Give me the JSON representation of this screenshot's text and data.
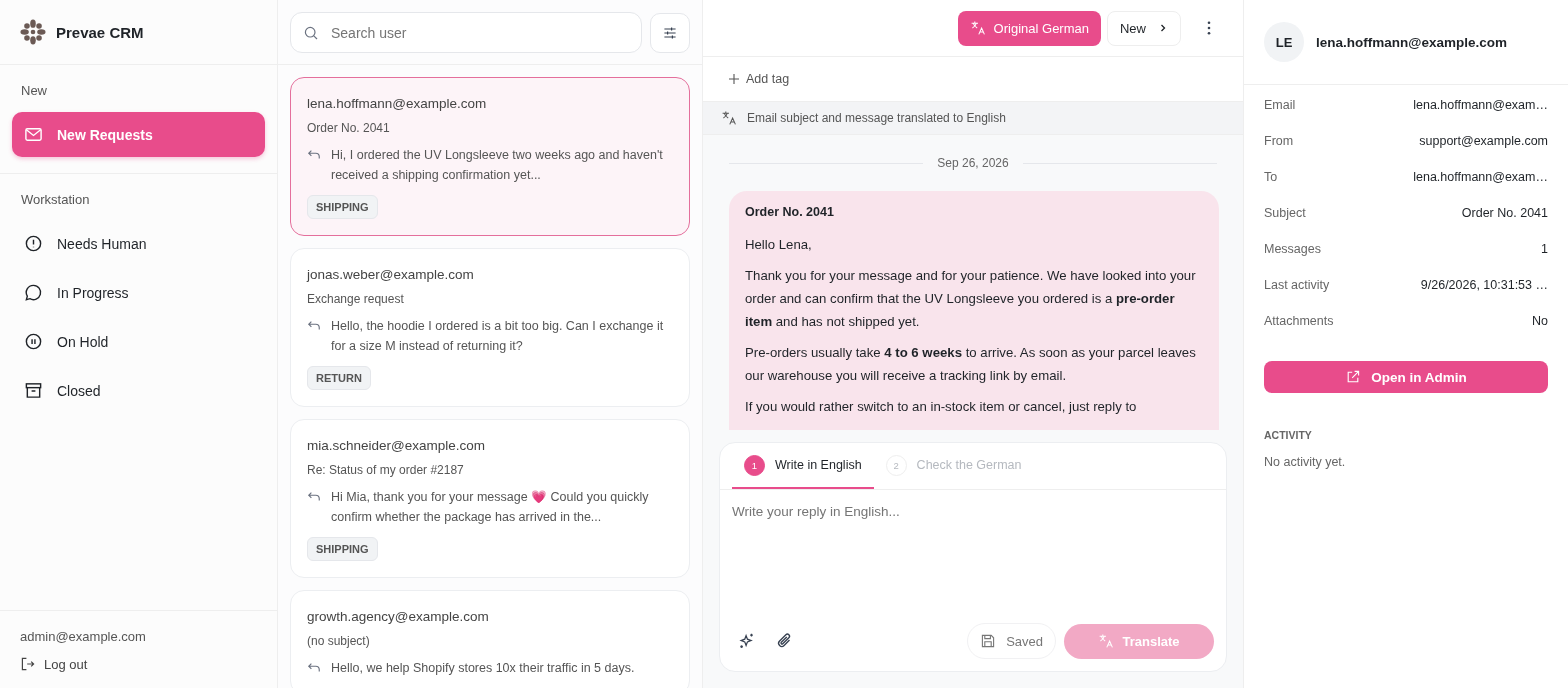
{
  "app": {
    "name": "Prevae CRM"
  },
  "sidebar": {
    "sections": [
      {
        "label": "New",
        "items": [
          {
            "label": "New Requests",
            "kind": "inbox",
            "selected": true
          }
        ]
      },
      {
        "label": "Workstation",
        "items": [
          {
            "label": "Needs Human",
            "kind": "alert",
            "selected": false
          },
          {
            "label": "In Progress",
            "kind": "chat",
            "selected": false
          },
          {
            "label": "On Hold",
            "kind": "pause",
            "selected": false
          },
          {
            "label": "Closed",
            "kind": "archive",
            "selected": false
          }
        ]
      }
    ],
    "user": "admin@example.com",
    "logout": "Log out"
  },
  "search": {
    "placeholder": "Search user"
  },
  "conversations": [
    {
      "email": "lena.hoffmann@example.com",
      "subject": "Order No. 2041",
      "preview": "Hi, I ordered the UV Longsleeve two weeks ago and haven't received a shipping confirmation yet...",
      "tag": "SHIPPING",
      "selected": true
    },
    {
      "email": "jonas.weber@example.com",
      "subject": "Exchange request",
      "preview": "Hello, the hoodie I ordered is a bit too big. Can I exchange it for a size M instead of returning it?",
      "tag": "RETURN",
      "selected": false
    },
    {
      "email": "mia.schneider@example.com",
      "subject": "Re: Status of my order #2187",
      "preview": "Hi Mia, thank you for your message 💗 Could you quickly confirm whether the package has arrived in the...",
      "tag": "SHIPPING",
      "selected": false
    },
    {
      "email": "growth.agency@example.com",
      "subject": "(no subject)",
      "preview": "Hello, we help Shopify stores 10x their traffic in 5 days.",
      "selected": false
    }
  ],
  "thread": {
    "original_button": "Original German",
    "status_button": "New",
    "add_tag": "Add tag",
    "translation_note": "Email subject and message translated to English",
    "date": "Sep 26, 2026",
    "message": {
      "subject": "Order No. 2041",
      "paragraphs": [
        "Hello Lena,",
        "Thank you for your message and for your patience. We have looked into your order and can confirm that the UV Longsleeve you ordered is a **pre-order item** and has not shipped yet.",
        "Pre-orders usually take **4 to 6 weeks** to arrive. As soon as your parcel leaves our warehouse you will receive a tracking link by email.",
        "If you would rather switch to an in-stock item or cancel, just reply to"
      ]
    }
  },
  "composer": {
    "steps": [
      {
        "number": "1",
        "label": "Write in English",
        "selected": true
      },
      {
        "number": "2",
        "label": "Check the German",
        "selected": false
      }
    ],
    "placeholder": "Write your reply in English...",
    "saved": "Saved",
    "translate": {
      "label": "Translate",
      "disabled": true
    }
  },
  "contact": {
    "initials": "LE",
    "email": "lena.hoffmann@example.com",
    "details": [
      {
        "label": "Email",
        "value": "lena.hoffmann@exam…"
      },
      {
        "label": "From",
        "value": "support@example.com"
      },
      {
        "label": "To",
        "value": "lena.hoffmann@exam…"
      },
      {
        "label": "Subject",
        "value": "Order No. 2041"
      },
      {
        "label": "Messages",
        "value": "1"
      },
      {
        "label": "Last activity",
        "value": "9/26/2026, 10:31:53 …"
      },
      {
        "label": "Attachments",
        "value": "No"
      }
    ],
    "open_button": "Open in Admin",
    "activity_heading": "ACTIVITY",
    "activity_empty": "No activity yet."
  }
}
